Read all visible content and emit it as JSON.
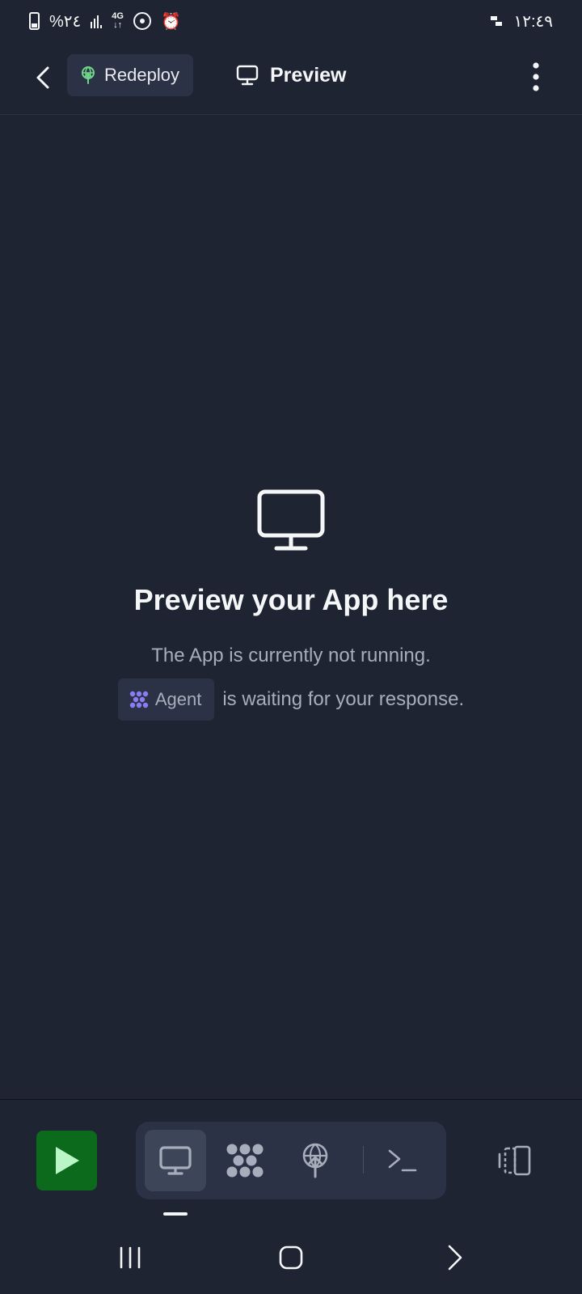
{
  "status_bar": {
    "battery_percent": "%٢٤",
    "network_type": "4G",
    "time": "١٢:٤٩"
  },
  "header": {
    "redeploy_label": "Redeploy",
    "tab_title": "Preview"
  },
  "main": {
    "title": "Preview your App here",
    "subtitle": "The App is currently not running.",
    "agent_chip_label": "Agent",
    "agent_status": "is waiting for your response."
  },
  "toolbar": {
    "tools": [
      "preview-tool",
      "agent-tool",
      "deploy-tool",
      "shell-tool"
    ],
    "active_tool": "preview-tool",
    "run_color": "#0b6a1c"
  },
  "colors": {
    "background": "#1f2433",
    "surface": "#2b3245",
    "accent_green": "#6fd68a",
    "agent_purple": "#8b7cf6"
  }
}
